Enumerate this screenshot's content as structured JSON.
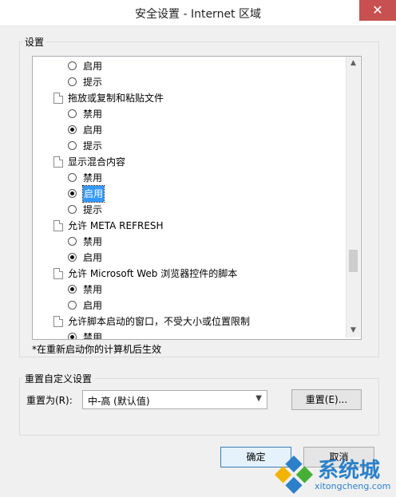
{
  "window": {
    "title": "安全设置 - Internet 区域",
    "close_symbol": "✕"
  },
  "settings_group": {
    "legend": "设置"
  },
  "items": [
    {
      "type": "radio",
      "label": "启用",
      "checked": false,
      "selected": false
    },
    {
      "type": "radio",
      "label": "提示",
      "checked": false,
      "selected": false
    },
    {
      "type": "header",
      "label": "拖放或复制和粘贴文件"
    },
    {
      "type": "radio",
      "label": "禁用",
      "checked": false,
      "selected": false
    },
    {
      "type": "radio",
      "label": "启用",
      "checked": true,
      "selected": false
    },
    {
      "type": "radio",
      "label": "提示",
      "checked": false,
      "selected": false
    },
    {
      "type": "header",
      "label": "显示混合内容"
    },
    {
      "type": "radio",
      "label": "禁用",
      "checked": false,
      "selected": false
    },
    {
      "type": "radio",
      "label": "启用",
      "checked": true,
      "selected": true
    },
    {
      "type": "radio",
      "label": "提示",
      "checked": false,
      "selected": false
    },
    {
      "type": "header",
      "label": "允许 META REFRESH"
    },
    {
      "type": "radio",
      "label": "禁用",
      "checked": false,
      "selected": false
    },
    {
      "type": "radio",
      "label": "启用",
      "checked": true,
      "selected": false
    },
    {
      "type": "header",
      "label": "允许 Microsoft Web 浏览器控件的脚本"
    },
    {
      "type": "radio",
      "label": "禁用",
      "checked": true,
      "selected": false
    },
    {
      "type": "radio",
      "label": "启用",
      "checked": false,
      "selected": false
    },
    {
      "type": "header",
      "label": "允许脚本启动的窗口，不受大小或位置限制"
    },
    {
      "type": "radio",
      "label": "禁用",
      "checked": true,
      "selected": false
    }
  ],
  "scrollbar": {
    "up": "▲",
    "down": "▼"
  },
  "note": "*在重新启动你的计算机后生效",
  "reset_group": {
    "legend": "重置自定义设置",
    "reset_to_label": "重置为(R):",
    "level_value": "中-高 (默认值)",
    "dropdown_symbol": "▼",
    "reset_button": "重置(E)..."
  },
  "buttons": {
    "ok": "确定",
    "cancel": "取消"
  },
  "watermark": {
    "text": "系统城",
    "url": "xitongcheng.com"
  }
}
